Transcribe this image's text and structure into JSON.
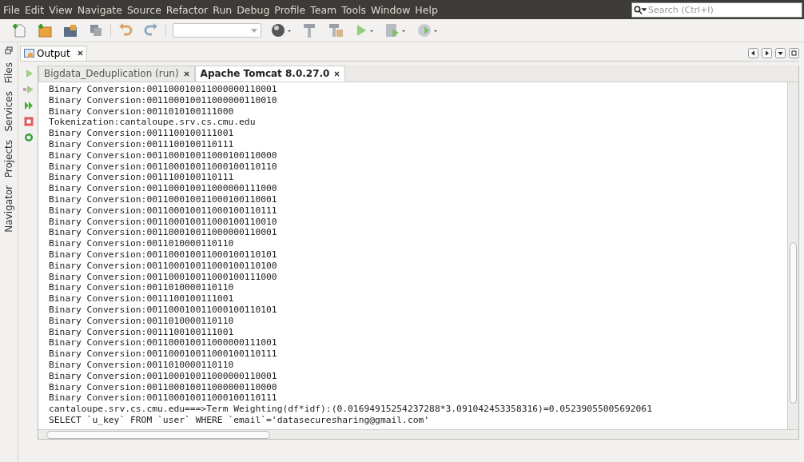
{
  "menu": [
    "File",
    "Edit",
    "View",
    "Navigate",
    "Source",
    "Refactor",
    "Run",
    "Debug",
    "Profile",
    "Team",
    "Tools",
    "Window",
    "Help"
  ],
  "search": {
    "placeholder": "Search (Ctrl+I)"
  },
  "side_tabs": [
    "Files",
    "Services",
    "Projects",
    "Navigator"
  ],
  "output": {
    "title": "Output",
    "sub_tabs": [
      {
        "label": "Bigdata_Deduplication (run)",
        "selected": false
      },
      {
        "label": "Apache Tomcat 8.0.27.0",
        "selected": true
      }
    ],
    "lines": [
      "Binary Conversion:001100010011000000110001",
      "Binary Conversion:001100010011000000110010",
      "Binary Conversion:0011010100111000",
      "Tokenization:cantaloupe.srv.cs.cmu.edu",
      "Binary Conversion:0011100100111001",
      "Binary Conversion:0011100100110111",
      "Binary Conversion:001100010011000100110000",
      "Binary Conversion:001100010011000100110110",
      "Binary Conversion:0011100100110111",
      "Binary Conversion:001100010011000000111000",
      "Binary Conversion:001100010011000100110001",
      "Binary Conversion:001100010011000100110111",
      "Binary Conversion:001100010011000100110010",
      "Binary Conversion:001100010011000000110001",
      "Binary Conversion:0011010000110110",
      "Binary Conversion:001100010011000100110101",
      "Binary Conversion:001100010011000100110100",
      "Binary Conversion:001100010011000100111000",
      "Binary Conversion:0011010000110110",
      "Binary Conversion:0011100100111001",
      "Binary Conversion:001100010011000100110101",
      "Binary Conversion:0011010000110110",
      "Binary Conversion:0011100100111001",
      "Binary Conversion:001100010011000000111001",
      "Binary Conversion:001100010011000100110111",
      "Binary Conversion:0011010000110110",
      "Binary Conversion:001100010011000000110001",
      "Binary Conversion:001100010011000000110000",
      "Binary Conversion:001100010011000100110111",
      "cantaloupe.srv.cs.cmu.edu===>Term Weighting(df*idf):(0.01694915254237288*3.091042453358316)=0.05239055005692061",
      "SELECT `u_key` FROM `user` WHERE `email`='datasecuresharing@gmail.com'"
    ]
  }
}
